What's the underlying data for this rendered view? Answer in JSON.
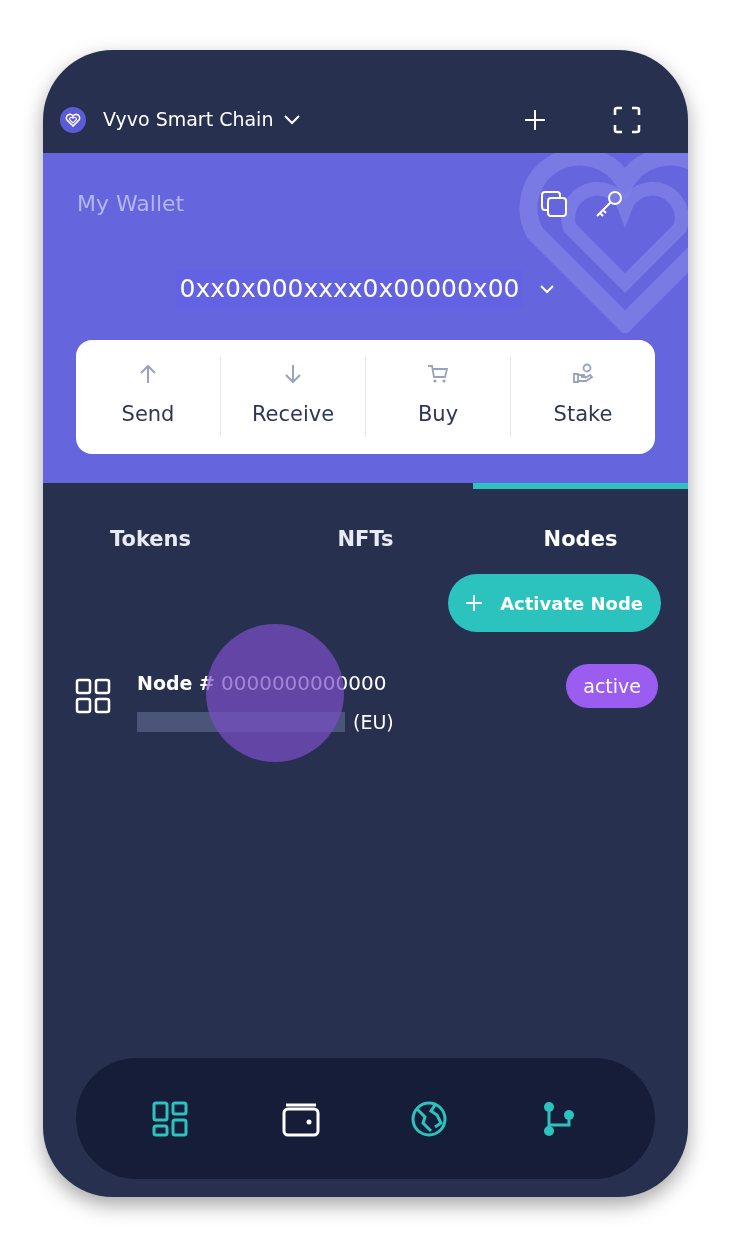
{
  "header": {
    "network": "Vyvo Smart Chain"
  },
  "wallet": {
    "title": "My Wallet",
    "address": "0xx0x000xxxx0x00000x00"
  },
  "actions": [
    {
      "kind": "send",
      "label": "Send"
    },
    {
      "kind": "receive",
      "label": "Receive"
    },
    {
      "kind": "buy",
      "label": "Buy"
    },
    {
      "kind": "stake",
      "label": "Stake"
    }
  ],
  "tabs": [
    {
      "label": "Tokens",
      "selected": false
    },
    {
      "label": "NFTs",
      "selected": false
    },
    {
      "label": "Nodes",
      "selected": true
    }
  ],
  "activate_button": {
    "label": "Activate Node"
  },
  "nodes": [
    {
      "label": "Node #",
      "number": "0000000000000",
      "region": "(EU)",
      "status": "active"
    }
  ],
  "bottom_nav": [
    {
      "kind": "dashboard",
      "selected": false
    },
    {
      "kind": "wallet",
      "selected": true
    },
    {
      "kind": "globe",
      "selected": false
    },
    {
      "kind": "branch",
      "selected": false
    }
  ]
}
